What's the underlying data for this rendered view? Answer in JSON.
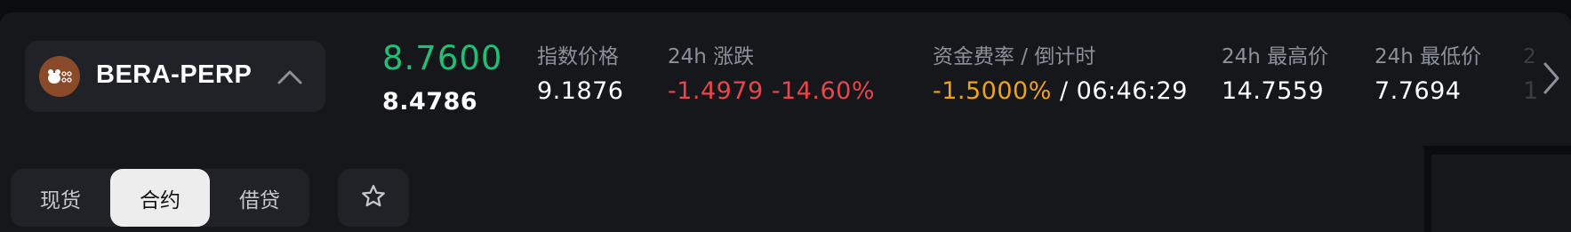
{
  "pair": {
    "icon": "bera-bear-icon",
    "name": "BERA-PERP",
    "logo_color": "#8a4a2a"
  },
  "ticker": {
    "last_price": "8.7600",
    "mark_price": "8.4786",
    "index_price_label": "指数价格",
    "index_price_value": "9.1876",
    "change_label": "24h 涨跌",
    "change_abs": "-1.4979",
    "change_pct": "-14.60%",
    "funding_label": "资金费率 / 倒计时",
    "funding_rate": "-1.5000%",
    "funding_sep": " / ",
    "funding_countdown": "06:46:29",
    "high_label": "24h 最高价",
    "high_value": "14.7559",
    "low_label": "24h 最低价",
    "low_value": "7.7694",
    "next_label_partial": "2",
    "next_value_partial": "1"
  },
  "tabs": [
    {
      "label": "现货",
      "active": false
    },
    {
      "label": "合约",
      "active": true
    },
    {
      "label": "借贷",
      "active": false
    }
  ],
  "icons": {
    "chevron": "chevron-up-icon",
    "next": "chevron-right-icon",
    "favorite": "star-icon"
  },
  "colors": {
    "up": "#1fbf75",
    "down": "#e8454c",
    "funding": "#f0a21a",
    "panel": "#15171b",
    "chip": "#202227",
    "page": "#0b0c0e"
  }
}
